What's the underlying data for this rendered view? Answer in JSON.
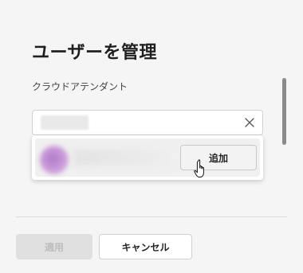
{
  "dialog": {
    "title": "ユーザーを管理",
    "field_label": "クラウドアテンダント"
  },
  "search": {
    "value": "",
    "placeholder": "",
    "clear_icon": "close-icon"
  },
  "results": [
    {
      "avatar_color": "#c08ad4",
      "add_label": "追加"
    }
  ],
  "footer": {
    "apply_label": "適用",
    "cancel_label": "キャンセル"
  },
  "colors": {
    "background": "#f5f5f5",
    "apply_disabled_bg": "#e0e0e0",
    "apply_disabled_text": "#bdbdbd"
  }
}
